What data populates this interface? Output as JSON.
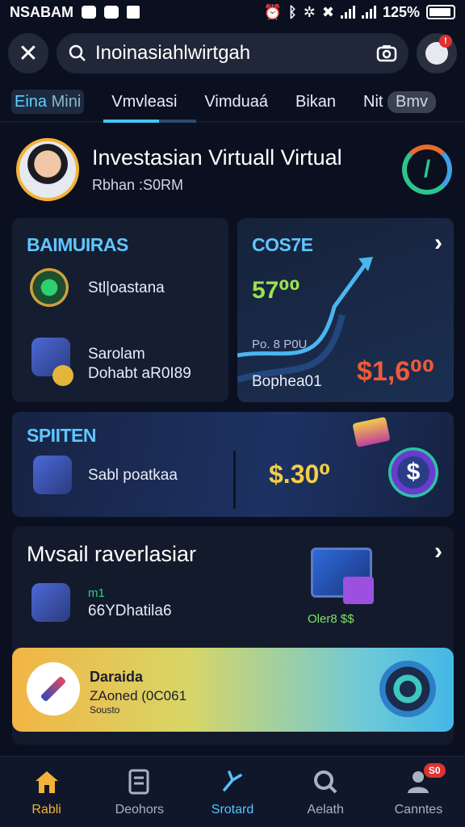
{
  "status_bar": {
    "app_label": "NSABAM",
    "battery": "125%"
  },
  "search": {
    "value": "Inoinasiahlwirtgah",
    "badge": "!"
  },
  "tabs": [
    {
      "label_a": "Eina",
      "label_b": "Mini"
    },
    {
      "label": "Vmvleasi"
    },
    {
      "label": "Vimduaá"
    },
    {
      "label": "Bikan"
    },
    {
      "label_a": "Nit",
      "label_b": "Bmv"
    }
  ],
  "profile": {
    "title": "Investasian Virtuall Virtual",
    "subtitle": "Rbhan :S0RM"
  },
  "card_left": {
    "heading": "BAIMUIRAS",
    "row1": "Stl|oastana",
    "row2_line1": "Sarolam",
    "row2_line2": "Dohabt aR0I89"
  },
  "card_right": {
    "heading": "COS7E",
    "value_green": "57⁰⁰",
    "small_label": "Po. 8 P0U",
    "bottom_label": "Bophea01",
    "value_red": "$1,6⁰⁰"
  },
  "card_mid": {
    "heading": "SPIITEN",
    "row": "Sabl poatkaa",
    "value_yellow": "$.30⁰"
  },
  "card_bottom": {
    "heading": "Mvsail raverlasiar",
    "row_small": "m1",
    "row": "66YDhatila6",
    "stat": "Oler8 $$"
  },
  "banner": {
    "title": "Daraida",
    "line1": "ZAoned (0C061",
    "line2": "Sousto"
  },
  "bottom_nav": [
    {
      "label": "Rabli"
    },
    {
      "label": "Deohors"
    },
    {
      "label": "Srotard"
    },
    {
      "label": "Aelath"
    },
    {
      "label": "Canntes",
      "badge": "S0"
    }
  ]
}
